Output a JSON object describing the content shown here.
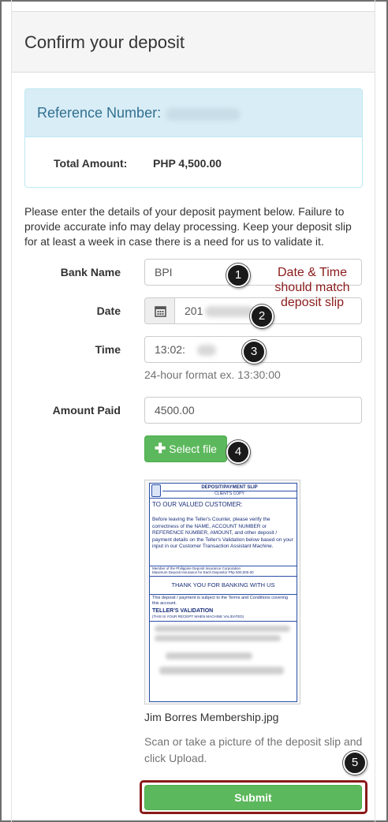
{
  "header": {
    "title": "Confirm your deposit"
  },
  "reference": {
    "label": "Reference Number:"
  },
  "total": {
    "label": "Total Amount:",
    "value": "PHP 4,500.00"
  },
  "instructions": "Please enter the details of your deposit payment below. Failure to provide accurate info may delay processing. Keep your deposit slip for at least a week in case there is a need for us to validate it.",
  "form": {
    "bank_name": {
      "label": "Bank Name",
      "value": "BPI"
    },
    "date": {
      "label": "Date",
      "value": "201",
      "icon": "calendar-icon"
    },
    "time": {
      "label": "Time",
      "value": "13:02:",
      "help": "24-hour format ex. 13:30:00"
    },
    "amount": {
      "label": "Amount Paid",
      "value": "4500.00"
    }
  },
  "upload": {
    "button_label": "Select file",
    "file_name": "Jim Borres Membership.jpg",
    "instructions": "Scan or take a picture of the deposit slip and click Upload."
  },
  "slip": {
    "header": "DEPOSIT/PAYMENT SLIP",
    "subheader": "CLIENT'S COPY",
    "greeting": "TO OUR VALUED CUSTOMER:",
    "body": "Before leaving the Teller's Counter, please verify the correctness of the NAME, ACCOUNT NUMBER or REFERENCE NUMBER, AMOUNT, and other deposit / payment details on the Teller's Validation below based on your input in our Customer Transaction Assistant Machine.",
    "pdic1": "Member of the Philippine Deposit Insurance Corporation",
    "pdic2": "Maximum Deposit Insurance for Each Depositor Php 500,000.00",
    "thanks": "THANK YOU FOR BANKING WITH US",
    "terms": "This deposit / payment is subject to the Terms and Conditions covering this account.",
    "validation": "TELLER'S VALIDATION",
    "validation_note": "(THIS IS YOUR RECEIPT WHEN MACHINE VALIDATED)"
  },
  "submit": {
    "label": "Submit"
  },
  "annotations": {
    "callout": "Date & Time should match deposit slip",
    "steps": [
      "1",
      "2",
      "3",
      "4",
      "5"
    ]
  }
}
